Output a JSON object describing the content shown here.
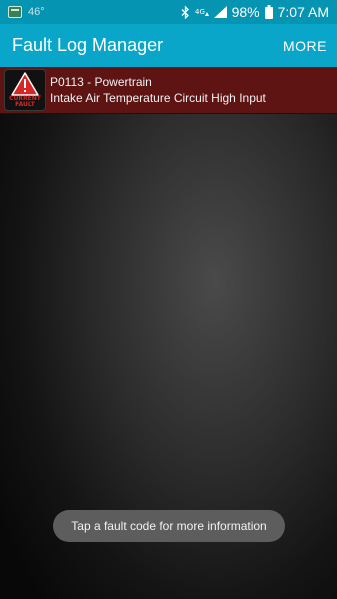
{
  "status_bar": {
    "temperature": "46°",
    "network": "4G",
    "battery": "98%",
    "time": "7:07 AM"
  },
  "app_bar": {
    "title": "Fault Log Manager",
    "more_label": "MORE"
  },
  "faults": [
    {
      "badge_text": "CURRENT FAULT",
      "code_line": "P0113 - Powertrain",
      "description": "Intake Air Temperature Circuit High Input"
    }
  ],
  "toast": {
    "message": "Tap a fault code for more information"
  },
  "colors": {
    "status_bar": "#0694b3",
    "app_bar": "#0aa6c9",
    "fault_row": "#5f1414",
    "badge_red": "#d72626"
  },
  "icons": [
    "notification-icon",
    "bluetooth-icon",
    "network-4g-icon",
    "signal-icon",
    "battery-icon",
    "warning-triangle-icon"
  ]
}
